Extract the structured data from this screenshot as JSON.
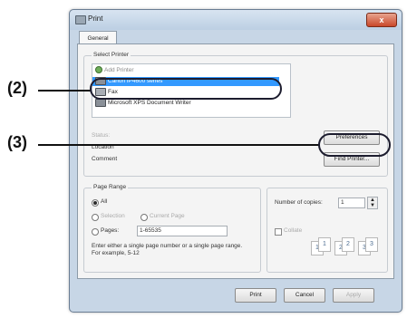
{
  "window": {
    "title": "Print",
    "close_label": "x"
  },
  "tabs": [
    {
      "label": "General"
    }
  ],
  "select_printer": {
    "label": "Select Printer",
    "items": [
      {
        "label": "Add Printer"
      },
      {
        "label": "Canon iP4600 series"
      },
      {
        "label": "Fax"
      },
      {
        "label": "Microsoft XPS Document Writer"
      }
    ]
  },
  "status": {
    "label": "Status:",
    "location_label": "Location",
    "comment_label": "Comment"
  },
  "buttons": {
    "preferences": "Preferences",
    "find_printer": "Find Printer...",
    "print": "Print",
    "cancel": "Cancel",
    "apply": "Apply"
  },
  "page_range": {
    "label": "Page Range",
    "all": "All",
    "selection": "Selection",
    "current_page": "Current Page",
    "pages": "Pages:",
    "pages_value": "1-65535",
    "hint": "Enter either a single page number or a single page range.  For example, 5-12"
  },
  "copies": {
    "number_label": "Number of copies:",
    "number_value": "1",
    "collate_label": "Collate",
    "collate_pages": [
      "1",
      "1",
      "2",
      "2",
      "3",
      "3"
    ]
  },
  "callouts": {
    "two": "(2)",
    "three": "(3)"
  }
}
